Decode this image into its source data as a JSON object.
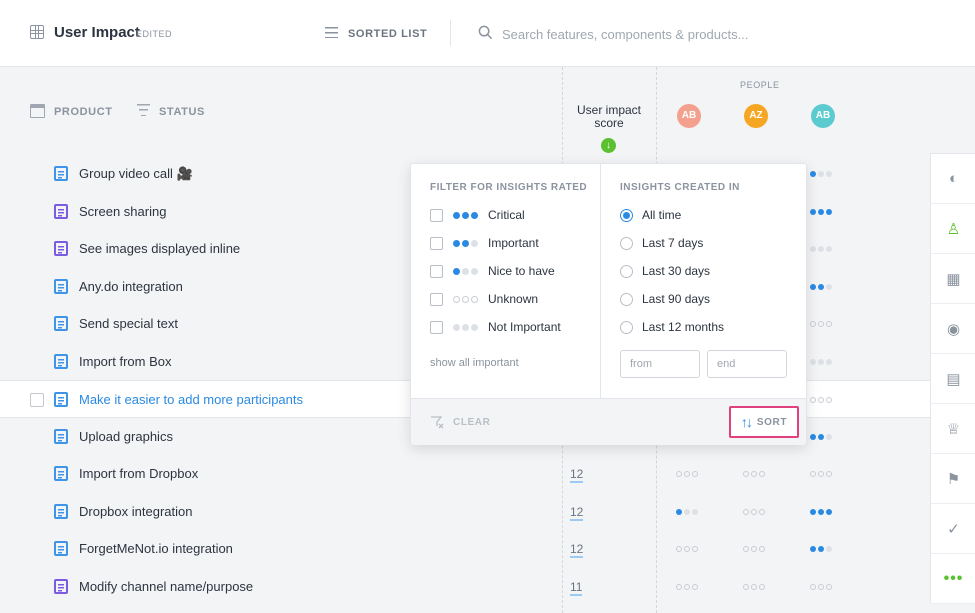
{
  "header": {
    "title": "User Impact",
    "edited_badge": "EDITED",
    "view_mode_label": "SORTED LIST",
    "search_placeholder": "Search features, components & products..."
  },
  "columns": {
    "product": "PRODUCT",
    "status": "STATUS",
    "score_line1": "User impact",
    "score_line2": "score",
    "people": "PEOPLE",
    "avatars": [
      {
        "initials": "AB",
        "color": "#f4a08f"
      },
      {
        "initials": "AZ",
        "color": "#f5a623"
      },
      {
        "initials": "AB",
        "color": "#5ccbd0"
      }
    ]
  },
  "rows": [
    {
      "name": "Group video call 🎥",
      "doc_color": "blue",
      "score": "",
      "selected": false
    },
    {
      "name": "Screen sharing",
      "doc_color": "purple",
      "score": "",
      "selected": false
    },
    {
      "name": "See images displayed inline",
      "doc_color": "purple",
      "score": "",
      "selected": false
    },
    {
      "name": "Any.do integration",
      "doc_color": "blue",
      "score": "",
      "selected": false
    },
    {
      "name": "Send special text",
      "doc_color": "blue",
      "score": "",
      "selected": false
    },
    {
      "name": "Import from Box",
      "doc_color": "blue",
      "score": "",
      "selected": false
    },
    {
      "name": "Make it easier to add more participants",
      "doc_color": "blue",
      "score": "",
      "selected": true
    },
    {
      "name": "Upload graphics",
      "doc_color": "blue",
      "score": "",
      "selected": false
    },
    {
      "name": "Import from Dropbox",
      "doc_color": "blue",
      "score": "12",
      "selected": false
    },
    {
      "name": "Dropbox integration",
      "doc_color": "blue",
      "score": "12",
      "selected": false
    },
    {
      "name": "ForgetMeNot.io integration",
      "doc_color": "blue",
      "score": "12",
      "selected": false
    },
    {
      "name": "Modify channel name/purpose",
      "doc_color": "purple",
      "score": "11",
      "selected": false
    }
  ],
  "ratings": [
    {
      "row": 0,
      "col": 2,
      "level": 1
    },
    {
      "row": 1,
      "col": 2,
      "level": 3
    },
    {
      "row": 2,
      "col": 2,
      "level": 0
    },
    {
      "row": 3,
      "col": 2,
      "level": 2
    },
    {
      "row": 4,
      "col": 2,
      "level": -1
    },
    {
      "row": 5,
      "col": 2,
      "level": 0
    },
    {
      "row": 6,
      "col": 2,
      "level": -1
    },
    {
      "row": 7,
      "col": 2,
      "level": 2
    },
    {
      "row": 8,
      "col": 0,
      "level": -1
    },
    {
      "row": 8,
      "col": 1,
      "level": -1
    },
    {
      "row": 8,
      "col": 2,
      "level": -1
    },
    {
      "row": 9,
      "col": 0,
      "level": 1
    },
    {
      "row": 9,
      "col": 1,
      "level": -1
    },
    {
      "row": 9,
      "col": 2,
      "level": 3
    },
    {
      "row": 10,
      "col": 0,
      "level": -1
    },
    {
      "row": 10,
      "col": 1,
      "level": -1
    },
    {
      "row": 10,
      "col": 2,
      "level": 2
    },
    {
      "row": 11,
      "col": 0,
      "level": -1
    },
    {
      "row": 11,
      "col": 1,
      "level": -1
    },
    {
      "row": 11,
      "col": 2,
      "level": -1
    }
  ],
  "filter": {
    "rated_title": "FILTER FOR INSIGHTS RATED",
    "rated_options": [
      {
        "label": "Critical",
        "dots": "critical"
      },
      {
        "label": "Important",
        "dots": "important"
      },
      {
        "label": "Nice to have",
        "dots": "nice"
      },
      {
        "label": "Unknown",
        "dots": "unknown"
      },
      {
        "label": "Not Important",
        "dots": "notimportant"
      }
    ],
    "show_all": "show all important",
    "created_title": "INSIGHTS CREATED IN",
    "created_options": [
      {
        "label": "All time",
        "checked": true
      },
      {
        "label": "Last 7 days",
        "checked": false
      },
      {
        "label": "Last 30 days",
        "checked": false
      },
      {
        "label": "Last 90 days",
        "checked": false
      },
      {
        "label": "Last 12 months",
        "checked": false
      }
    ],
    "from_placeholder": "from",
    "end_placeholder": "end",
    "clear_label": "CLEAR",
    "sort_label": "SORT"
  },
  "sidebar_icons": [
    "pie-chart-icon",
    "person-icon",
    "building-icon",
    "target-icon",
    "calculator-icon",
    "trophy-icon",
    "flag-icon",
    "check-circle-icon",
    "more-icon"
  ],
  "colors": {
    "accent": "#2a8ae3",
    "green": "#5cc130",
    "highlight": "#e0407e"
  }
}
